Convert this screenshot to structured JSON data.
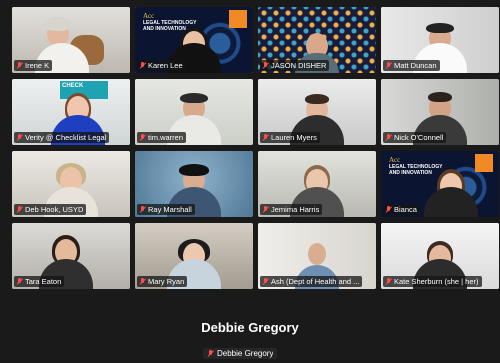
{
  "participants": [
    {
      "name": "Irene K"
    },
    {
      "name": "Karen Lee"
    },
    {
      "name": "JASON DISHER"
    },
    {
      "name": "Matt Duncan"
    },
    {
      "name": "Verity @ Checklist Legal"
    },
    {
      "name": "tim.warren"
    },
    {
      "name": "Lauren Myers"
    },
    {
      "name": "Nick O'Connell"
    },
    {
      "name": "Deb Hook, USYD"
    },
    {
      "name": "Ray Marshall"
    },
    {
      "name": "Jemima Harris"
    },
    {
      "name": "Bianca"
    },
    {
      "name": "Tara Eaton"
    },
    {
      "name": "Mary Ryan"
    },
    {
      "name": "Ash (Dept of Health and ..."
    },
    {
      "name": "Kate Sherburn (she | her)"
    }
  ],
  "slide": {
    "brand": "Acc",
    "title": "LEGAL TECHNOLOGY AND INNOVATION"
  },
  "verity_sign": "CHECK",
  "active_speaker": {
    "display_name": "Debbie Gregory",
    "label": "Debbie Gregory"
  },
  "colors": {
    "muted": "#ff4d4d",
    "active_border": "#e6e13a",
    "background": "#1a1a1a"
  },
  "icons": {
    "muted": "mic-muted-icon"
  }
}
